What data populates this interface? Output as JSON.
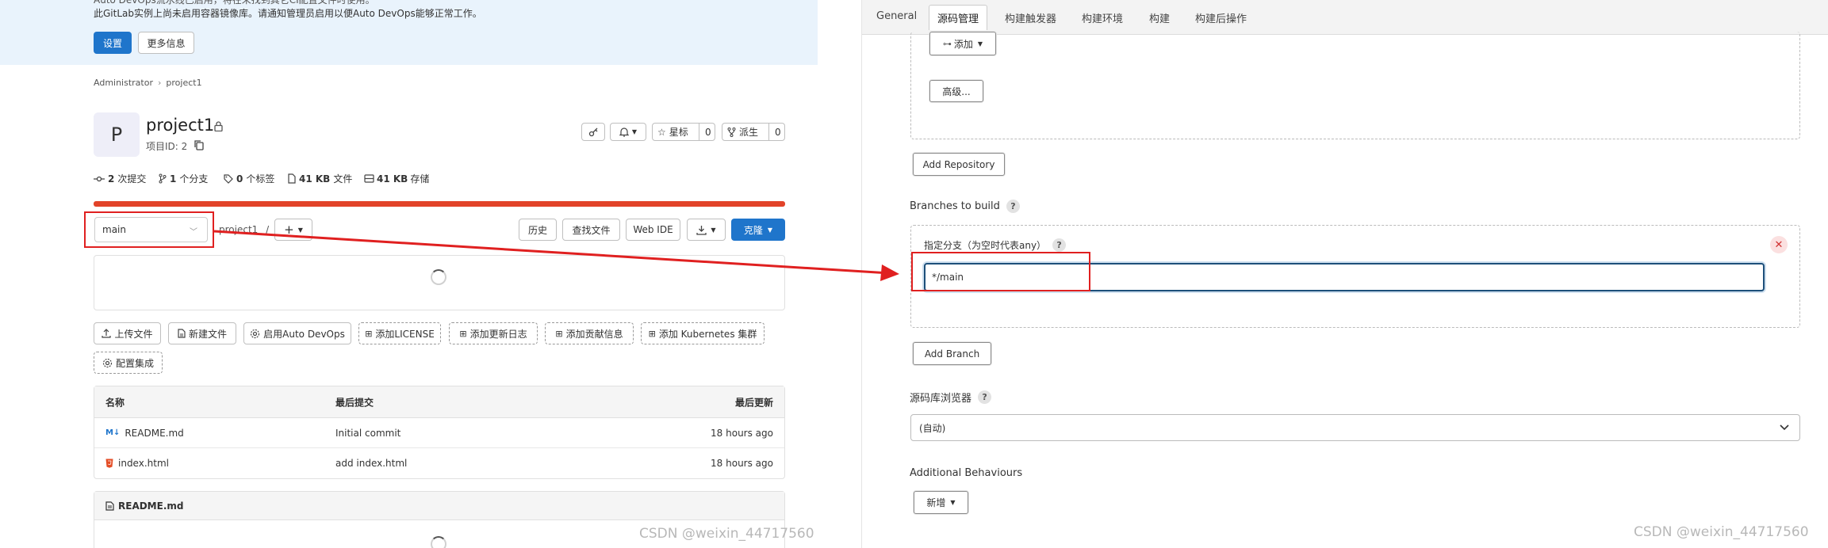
{
  "gitlab": {
    "banner": {
      "line_cut": "Auto DevOps流水线已启用，将在未找到其它CI配置文件时使用。",
      "line": "此GitLab实例上尚未启用容器镜像库。请通知管理员启用以便Auto DevOps能够正常工作。",
      "settings_label": "设置",
      "more_info_label": "更多信息"
    },
    "breadcrumb": [
      "Administrator",
      "project1"
    ],
    "project": {
      "avatar_letter": "P",
      "name": "project1",
      "id_text": "项目ID: 2"
    },
    "header_actions": {
      "star_label": "星标",
      "star_count": "0",
      "fork_label": "派生",
      "fork_count": "0"
    },
    "stats": [
      {
        "value": "2",
        "label": "次提交",
        "icon": "commit-icon"
      },
      {
        "value": "1",
        "label": "个分支",
        "icon": "branch-icon"
      },
      {
        "value": "0",
        "label": "个标签",
        "icon": "tag-icon"
      },
      {
        "value": "41 KB",
        "label": "文件",
        "icon": "file-icon"
      },
      {
        "value": "41 KB",
        "label": "存储",
        "icon": "storage-icon"
      }
    ],
    "branch": "main",
    "path": "project1",
    "path_sep": "/",
    "add_label": "+",
    "toolbar": {
      "history": "历史",
      "find_file": "查找文件",
      "web_ide": "Web IDE",
      "clone": "克隆"
    },
    "actions": [
      "上传文件",
      "新建文件",
      "启用Auto DevOps",
      "添加LICENSE",
      "添加更新日志",
      "添加贡献信息",
      "添加 Kubernetes 集群",
      "配置集成"
    ],
    "table": {
      "headers": [
        "名称",
        "最后提交",
        "最后更新"
      ],
      "rows": [
        {
          "name": "README.md",
          "commit": "Initial commit",
          "updated": "18 hours ago",
          "icon": "markdown-icon"
        },
        {
          "name": "index.html",
          "commit": "add index.html",
          "updated": "18 hours ago",
          "icon": "html-icon"
        }
      ]
    },
    "readme_title": "README.md",
    "watermark": "CSDN @weixin_44717560"
  },
  "jenkins": {
    "tabs": [
      "General",
      "源码管理",
      "构建触发器",
      "构建环境",
      "构建",
      "构建后操作"
    ],
    "active_tab": "源码管理",
    "add_label": "添加",
    "advanced_label": "高级...",
    "add_repository": "Add Repository",
    "branches_to_build": "Branches to build",
    "branch_spec_label": "指定分支（为空时代表any）",
    "branch_spec_value": "*/main",
    "add_branch": "Add Branch",
    "repo_browser_label": "源码库浏览器",
    "repo_browser_value": "(自动)",
    "additional_behaviours": "Additional Behaviours",
    "new_label": "新增",
    "help_mark": "?",
    "watermark": "CSDN @weixin_44717560"
  },
  "colors": {
    "gitlab_blue": "#1f75cb",
    "gitlab_orange": "#e24329",
    "annotation_red": "#e02020",
    "jenkins_focus": "#1d4f7a"
  }
}
